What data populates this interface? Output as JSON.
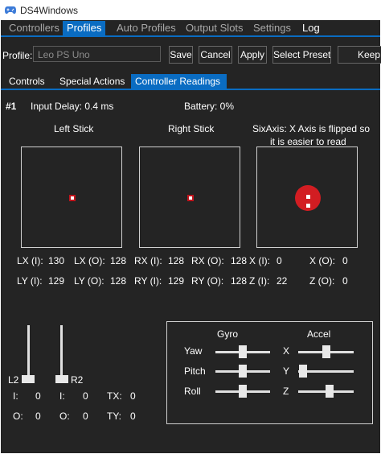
{
  "window": {
    "title": "DS4Windows"
  },
  "main_tabs": [
    {
      "label": "Controllers"
    },
    {
      "label": "Profiles"
    },
    {
      "label": "Auto Profiles"
    },
    {
      "label": "Output Slots"
    },
    {
      "label": "Settings"
    },
    {
      "label": "Log"
    }
  ],
  "profile": {
    "label": "Profile:",
    "value": "Leo PS Uno",
    "buttons": {
      "save": "Save",
      "cancel": "Cancel",
      "apply": "Apply",
      "select_preset": "Select Preset",
      "keep": "Keep"
    }
  },
  "sub_tabs": [
    {
      "label": "Controls"
    },
    {
      "label": "Special Actions"
    },
    {
      "label": "Controller Readings"
    }
  ],
  "readings": {
    "controller_number": "#1",
    "input_delay": "Input Delay: 0.4 ms",
    "battery": "Battery: 0%",
    "left_stick_title": "Left Stick",
    "right_stick_title": "Right Stick",
    "sixaxis_title_line1": "SixAxis: X Axis is flipped so",
    "sixaxis_title_line2": "it is easier to read",
    "left_stick": {
      "lx_i_label": "LX (I):",
      "lx_i": "130",
      "lx_o_label": "LX (O):",
      "lx_o": "128",
      "ly_i_label": "LY (I):",
      "ly_i": "129",
      "ly_o_label": "LY (O):",
      "ly_o": "128"
    },
    "right_stick": {
      "rx_i_label": "RX (I):",
      "rx_i": "128",
      "rx_o_label": "RX (O):",
      "rx_o": "128",
      "ry_i_label": "RY (I):",
      "ry_i": "129",
      "ry_o_label": "RY (O):",
      "ry_o": "128"
    },
    "sixaxis": {
      "x_i_label": "X (I):",
      "x_i": "0",
      "x_o_label": "X (O):",
      "x_o": "0",
      "z_i_label": "Z (I):",
      "z_i": "22",
      "z_o_label": "Z (O):",
      "z_o": "0"
    },
    "triggers": {
      "l2_label": "L2",
      "r2_label": "R2",
      "l2_i_label": "I:",
      "l2_i": "0",
      "l2_o_label": "O:",
      "l2_o": "0",
      "r2_i_label": "I:",
      "r2_i": "0",
      "r2_o_label": "O:",
      "r2_o": "0",
      "tx_label": "TX:",
      "tx": "0",
      "ty_label": "TY:",
      "ty": "0",
      "l2_level": 0,
      "r2_level": 0
    },
    "motion": {
      "gyro_title": "Gyro",
      "accel_title": "Accel",
      "yaw_label": "Yaw",
      "pitch_label": "Pitch",
      "roll_label": "Roll",
      "x_label": "X",
      "y_label": "Y",
      "z_label": "Z",
      "yaw": 0.5,
      "pitch": 0.5,
      "roll": 0.5,
      "accel_x": 0.5,
      "accel_y": 0.02,
      "accel_z": 0.57
    }
  },
  "colors": {
    "accent": "#0a6cc2",
    "background": "#242424",
    "indicator_red": "#d21d22"
  }
}
